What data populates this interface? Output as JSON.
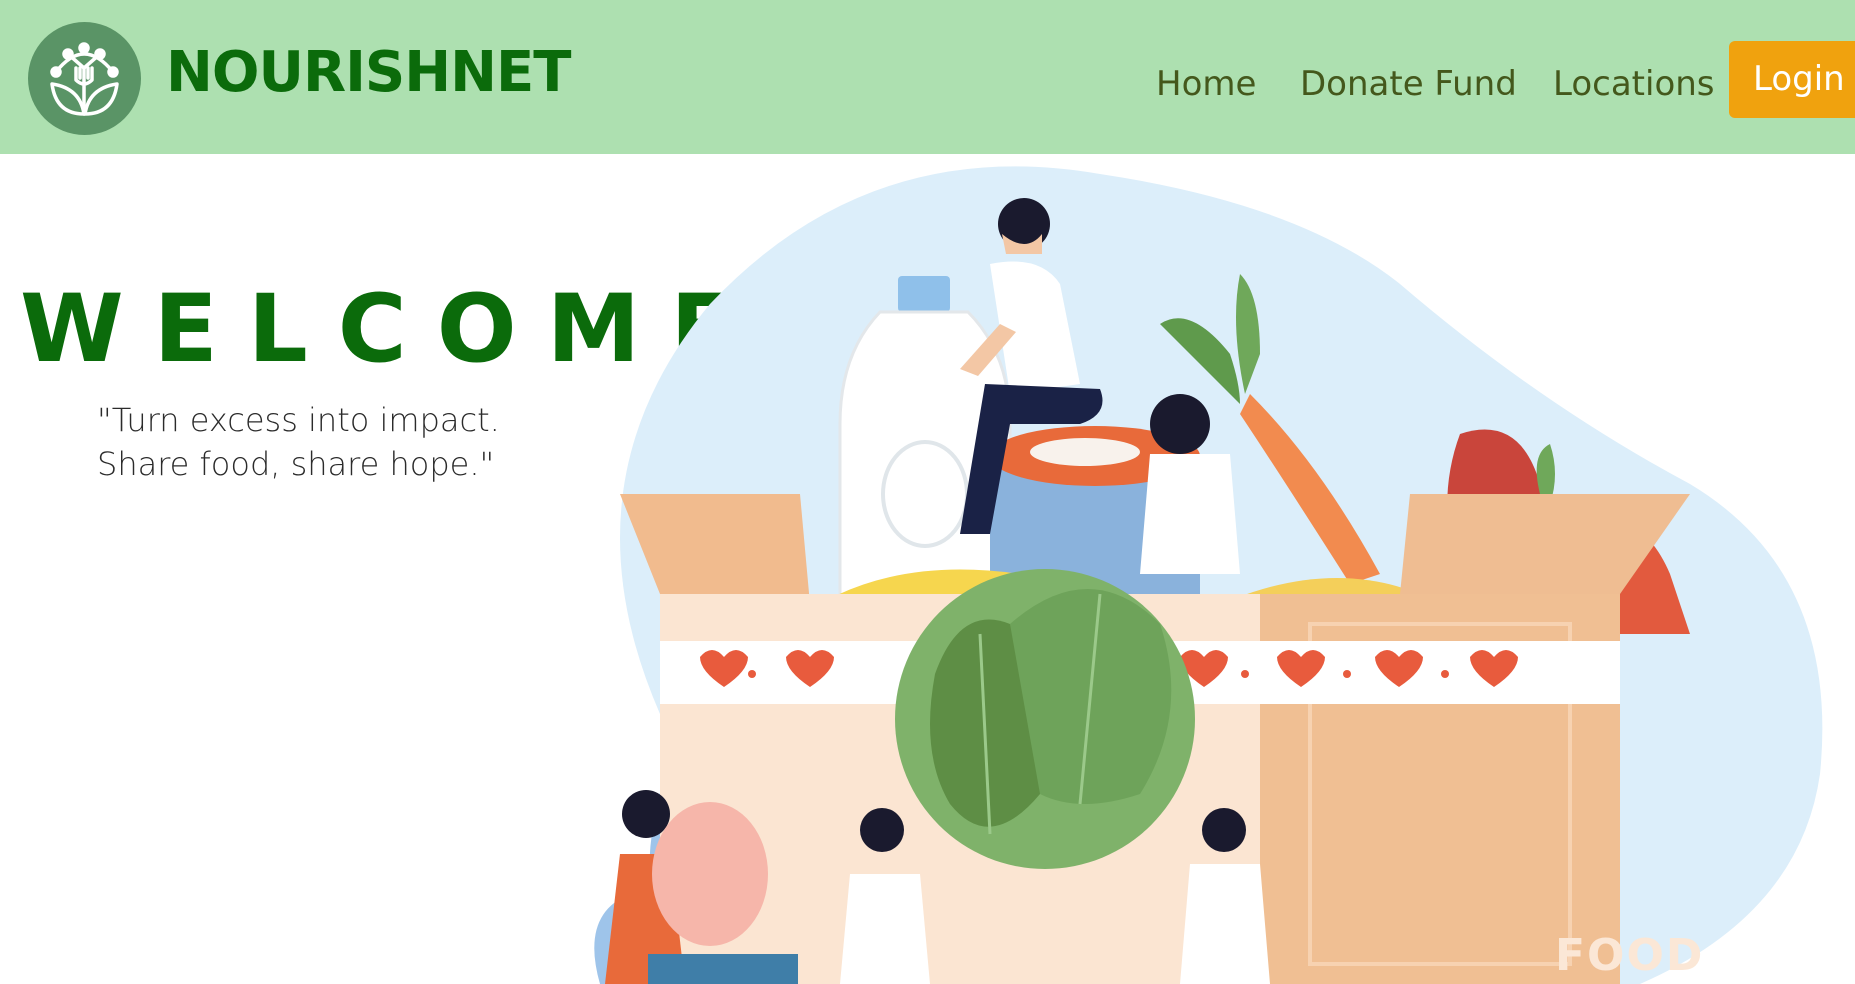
{
  "header": {
    "brand": "NOURISHNET",
    "logo_icon": "nourishnet-logo-icon",
    "nav": {
      "home": "Home",
      "donate_fund": "Donate Fund",
      "locations": "Locations"
    },
    "login_label": "Login"
  },
  "hero": {
    "welcome": "WELCOME",
    "tagline_line1": "\"Turn excess into impact.",
    "tagline_line2": "Share food, share hope.\"",
    "illustration_box_label": "FOOD"
  },
  "colors": {
    "navbar_bg": "#ade0b0",
    "brand_green": "#0b6b0b",
    "nav_text": "#44581c",
    "login_bg": "#f0a20e"
  }
}
